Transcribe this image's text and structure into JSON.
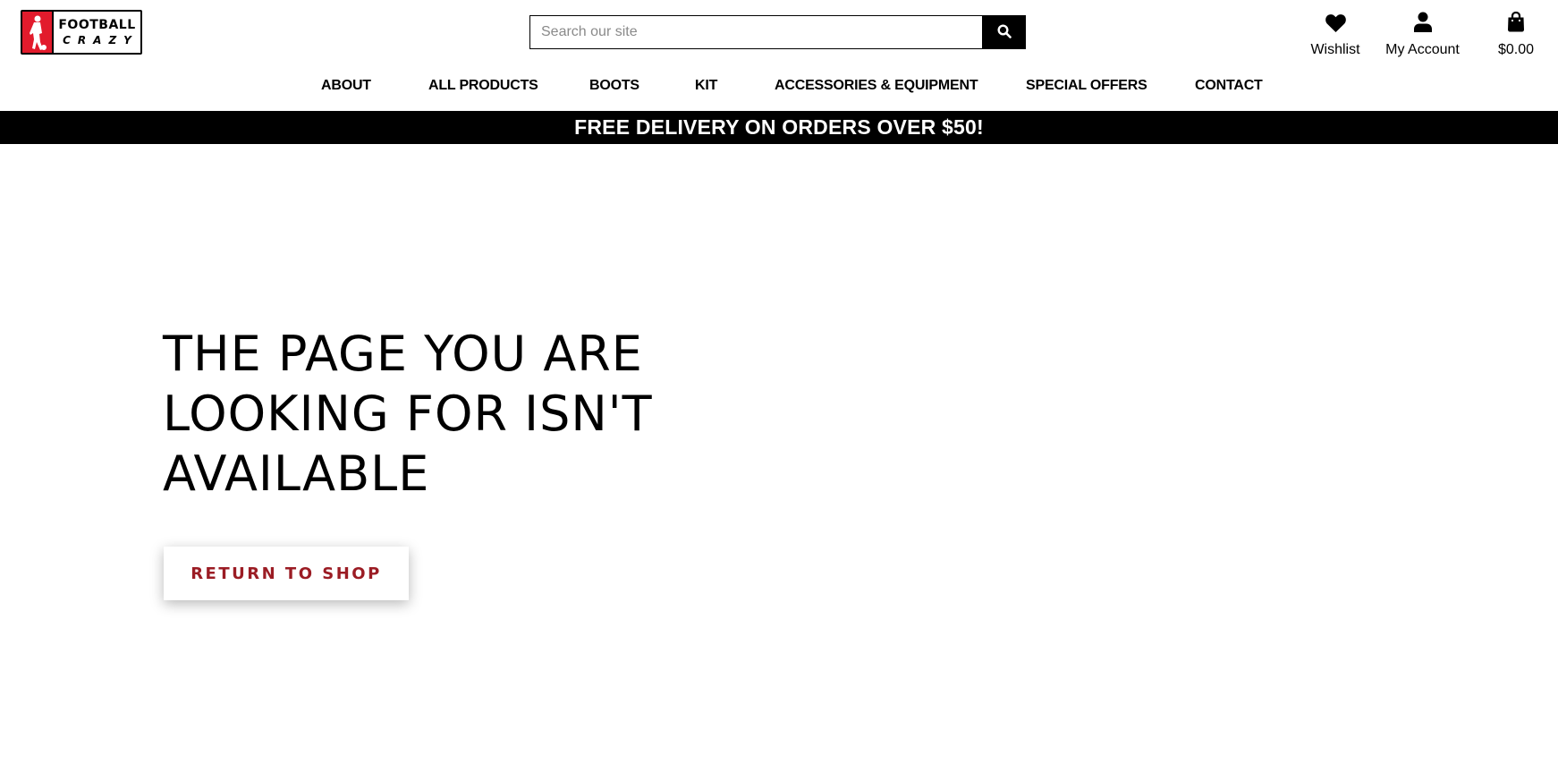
{
  "header": {
    "logo": {
      "line1": "FOOTBALL",
      "line2": "CRAZY",
      "brand_color": "#e21b2c"
    },
    "search": {
      "placeholder": "Search our site",
      "value": "",
      "button_icon": "search-icon"
    },
    "utilities": {
      "wishlist": {
        "label": "Wishlist",
        "icon": "heart-icon"
      },
      "account": {
        "label": "My Account",
        "icon": "user-icon"
      },
      "cart": {
        "label": "$0.00",
        "icon": "shopping-bag-icon"
      }
    },
    "nav": {
      "items": [
        {
          "label": "ABOUT"
        },
        {
          "label": "ALL PRODUCTS"
        },
        {
          "label": "BOOTS"
        },
        {
          "label": "KIT"
        },
        {
          "label": "ACCESSORIES & EQUIPMENT"
        },
        {
          "label": "SPECIAL OFFERS"
        },
        {
          "label": "CONTACT"
        }
      ]
    }
  },
  "banner": {
    "text": "FREE DELIVERY ON ORDERS OVER $50!"
  },
  "main": {
    "title": "THE PAGE YOU ARE LOOKING FOR ISN'T AVAILABLE",
    "return_button_label": "RETURN TO SHOP",
    "accent_color": "#9b1c24"
  }
}
